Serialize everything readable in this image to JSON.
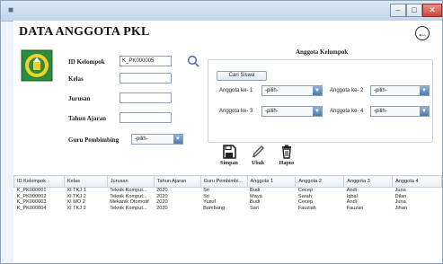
{
  "form": {
    "title": "DATA ANGGOTA PKL",
    "fields": {
      "kelompok_label": "ID Kelompok",
      "kelompok_value": "K_PK000005",
      "kelas_label": "Kelas",
      "jurusan_label": "Jurusan",
      "tahun_label": "Tahun Ajaran",
      "guru_label": "Guru Pembimbing",
      "guru_select": "-pilih-"
    },
    "group": {
      "title": "Anggota Kelompok",
      "cari_button": "Cari Siswa",
      "anggota1_label": "Anggota ke- 1",
      "anggota1_value": "-pilih-",
      "anggota2_label": "Anggota ke- 2",
      "anggota2_value": "-pilih-",
      "anggota3_label": "Anggota ke- 3",
      "anggota3_value": "-pilih-",
      "anggota4_label": "Anggota ke- 4",
      "anggota4_value": "-pilih-"
    },
    "actions": {
      "simpan": "Simpan",
      "ubah": "Ubah",
      "hapus": "Hapus"
    }
  },
  "table": {
    "columns": [
      "ID Kelompok",
      "Kelas",
      "Jurusan",
      "Tahun Ajaran",
      "Guru Pembimbi...",
      "Anggota 1",
      "Anggota 2",
      "Anggota 3",
      "Anggota 4"
    ],
    "rows": [
      [
        "K_PK000001",
        "XI TKJ 1",
        "Teknik Komput...",
        "2020",
        "Sri",
        "Budi",
        "Cecep",
        "Andi",
        "Juna"
      ],
      [
        "K_PK000002",
        "XI TKJ 2",
        "Teknik Komput...",
        "2020",
        "Sri",
        "Maya",
        "Sarah",
        "Iqbal",
        "Dilan"
      ],
      [
        "K_PK000003",
        "XI MO 2",
        "Mekanik Otomotif",
        "2020",
        "Yusuf",
        "Budi",
        "Cecep",
        "Andi",
        "Juna"
      ],
      [
        "K_PK000004",
        "XI TKJ 2",
        "Teknik Komput...",
        "2020",
        "Bambang",
        "Sari",
        "Fauziah",
        "Fauzan",
        "Jihan"
      ]
    ]
  },
  "colors": {
    "window_bg": "#eef4fa",
    "accent_blue": "#4c79b0",
    "logo_green": "#2e8b3d",
    "logo_yellow": "#f1d22b"
  }
}
